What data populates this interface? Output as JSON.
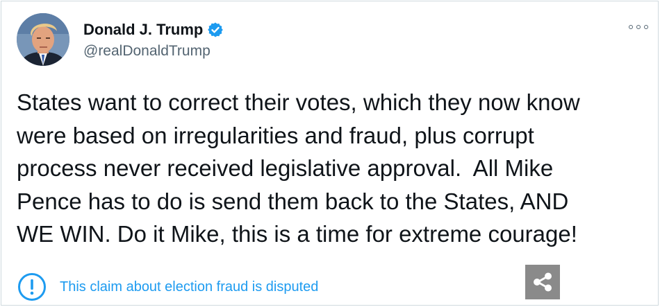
{
  "tweet": {
    "author": {
      "name": "Donald J. Trump",
      "handle": "@realDonaldTrump",
      "verified": true,
      "avatar_icon": "profile-photo"
    },
    "text": "States want to correct their votes, which they now know\nwere based on irregularities and fraud, plus corrupt\nprocess never received legislative approval.  All Mike\nPence has to do is send them back to the States, AND\nWE WIN. Do it Mike, this is a time for extreme courage!",
    "notice": {
      "icon": "info-circle-icon",
      "text": "This claim about election fraud is disputed"
    },
    "more_icon": "more-dots-icon",
    "share_icon": "share-icon"
  },
  "colors": {
    "verified_blue": "#1d9bf0",
    "text": "#0f1419",
    "muted": "#536471",
    "share_bg": "#8a8a8a",
    "border": "#cfd9de"
  }
}
